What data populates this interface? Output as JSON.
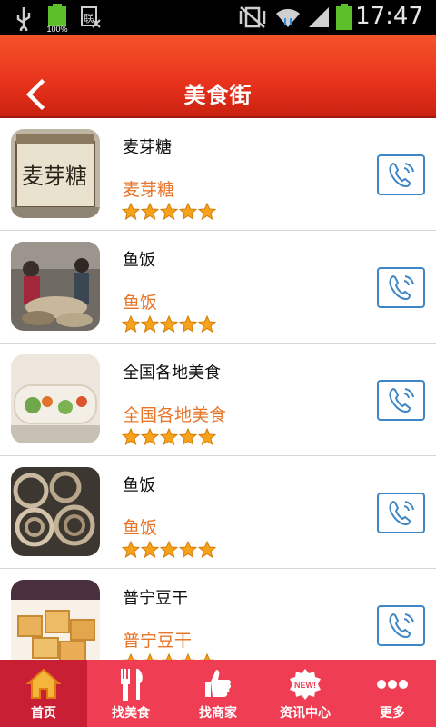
{
  "status": {
    "time": "17:47",
    "battery_level": "100%"
  },
  "header": {
    "title": "美食街",
    "back_icon": "chevron-left-icon"
  },
  "list": [
    {
      "name": "麦芽糖",
      "subtitle": "麦芽糖",
      "rating": 5
    },
    {
      "name": "鱼饭",
      "subtitle": "鱼饭",
      "rating": 5
    },
    {
      "name": "全国各地美食",
      "subtitle": "全国各地美食",
      "rating": 5
    },
    {
      "name": "鱼饭",
      "subtitle": "鱼饭",
      "rating": 5
    },
    {
      "name": "普宁豆干",
      "subtitle": "普宁豆干",
      "rating": 5
    }
  ],
  "tabs": [
    {
      "label": "首页",
      "icon": "home-icon",
      "active": true
    },
    {
      "label": "找美食",
      "icon": "fork-knife-icon",
      "active": false
    },
    {
      "label": "找商家",
      "icon": "thumbs-up-icon",
      "active": false
    },
    {
      "label": "资讯中心",
      "icon": "new-badge-icon",
      "active": false
    },
    {
      "label": "更多",
      "icon": "more-dots-icon",
      "active": false
    }
  ],
  "colors": {
    "header": "#e8321c",
    "accent_text": "#e8762a",
    "tabbar": "#ef3e54",
    "call_border": "#3f86c4"
  }
}
